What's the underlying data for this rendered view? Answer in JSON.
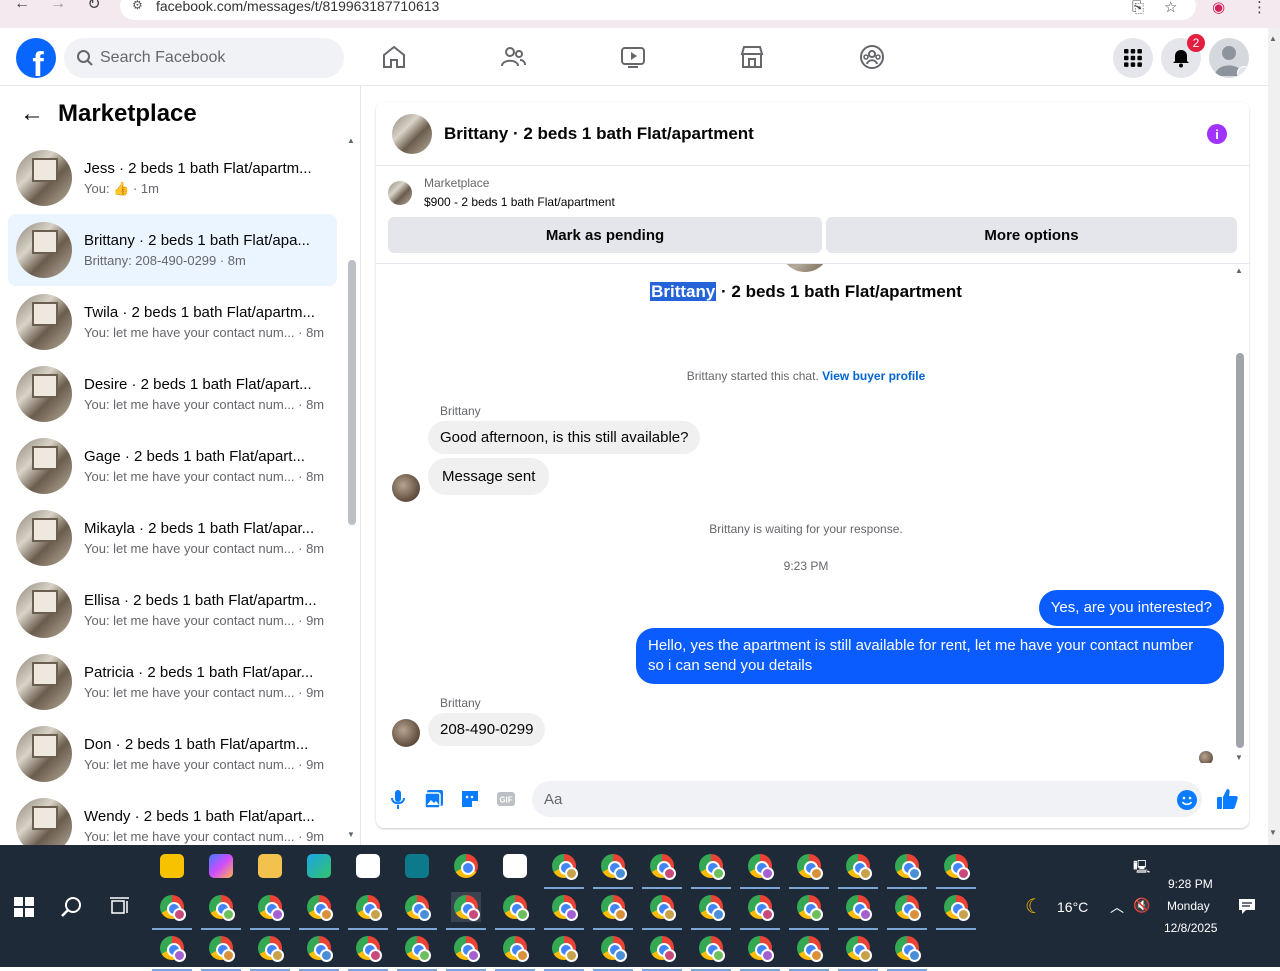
{
  "browser": {
    "url": "facebook.com/messages/t/819963187710613",
    "back_icon": "arrow-left-icon",
    "forward_icon": "arrow-right-icon",
    "reload_icon": "reload-icon"
  },
  "header": {
    "search_placeholder": "Search Facebook",
    "notifications_count": "2",
    "brand_color": "#0866ff"
  },
  "left_panel": {
    "title": "Marketplace",
    "conversations": [
      {
        "name": "Jess · 2 beds 1 bath Flat/apartm...",
        "sub": "You: 👍 · 1m",
        "active": false
      },
      {
        "name": "Brittany · 2 beds 1 bath Flat/apa...",
        "sub": "Brittany: 208-490-0299 · 8m",
        "active": true
      },
      {
        "name": "Twila · 2 beds 1 bath Flat/apartm...",
        "sub": "You: let me have your contact num... · 8m",
        "active": false
      },
      {
        "name": "Desire · 2 beds 1 bath Flat/apart...",
        "sub": "You: let me have your contact num... · 8m",
        "active": false
      },
      {
        "name": "Gage · 2 beds 1 bath Flat/apart...",
        "sub": "You: let me have your contact num... · 8m",
        "active": false
      },
      {
        "name": "Mikayla · 2 beds 1 bath Flat/apar...",
        "sub": "You: let me have your contact num... · 8m",
        "active": false
      },
      {
        "name": "Ellisa · 2 beds 1 bath Flat/apartm...",
        "sub": "You: let me have your contact num... · 9m",
        "active": false
      },
      {
        "name": "Patricia · 2 beds 1 bath Flat/apar...",
        "sub": "You: let me have your contact num... · 9m",
        "active": false
      },
      {
        "name": "Don · 2 beds 1 bath Flat/apartm...",
        "sub": "You: let me have your contact num... · 9m",
        "active": false
      },
      {
        "name": "Wendy · 2 beds 1 bath Flat/apart...",
        "sub": "You: let me have your contact num... · 9m",
        "active": false
      }
    ]
  },
  "chat": {
    "title": "Brittany · 2 beds 1 bath Flat/apartment",
    "marketplace_label": "Marketplace",
    "listing": "$900 - 2 beds 1 bath Flat/apartment",
    "mark_pending": "Mark as pending",
    "more_options": "More options",
    "conv_title_name": "Brittany",
    "conv_title_rest": " · 2 beds 1 bath Flat/apartment",
    "started_text": "Brittany started this chat. ",
    "view_buyer_profile": "View buyer profile",
    "sender_name": "Brittany",
    "msg1": "Good afternoon, is this still available?",
    "msg2": "Message sent",
    "waiting": "Brittany is waiting for your response.",
    "time": "9:23 PM",
    "out1": "Yes, are you interested?",
    "out2": "Hello, yes the apartment is still available for rent, let me have your contact number so i can send you details",
    "msg3": "208-490-0299",
    "composer_placeholder": "Aa"
  },
  "taskbar": {
    "weather": "16°C",
    "time": "9:28 PM",
    "day": "Monday",
    "date": "12/8/2025"
  }
}
